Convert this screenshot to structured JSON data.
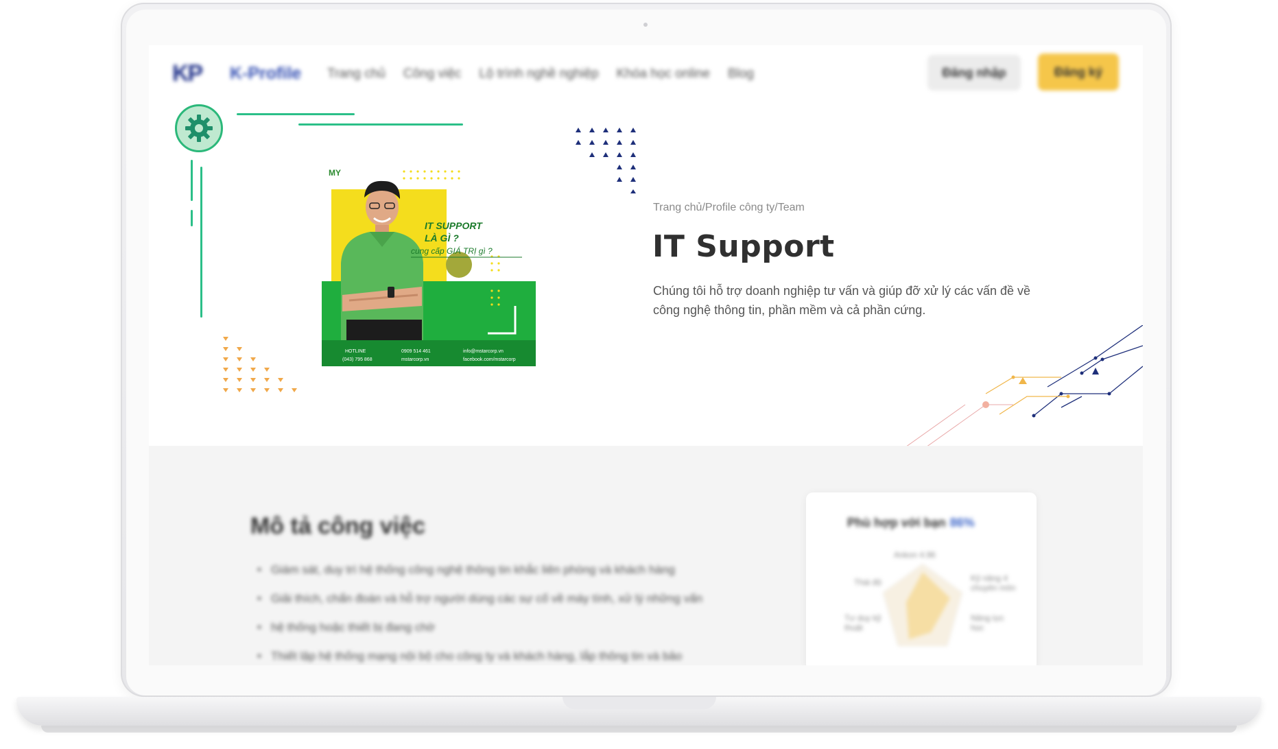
{
  "nav": {
    "logo_mark": "KP",
    "logo_text": "K-Profile",
    "links": [
      "Trang chủ",
      "Công việc",
      "Lộ trình nghề nghiệp",
      "Khóa học online",
      "Blog"
    ],
    "login_label": "Đăng nhập",
    "register_label": "Đăng ký"
  },
  "hero": {
    "breadcrumb": "Trang chủ/Profile công ty/Team",
    "title": "IT Support",
    "description": "Chúng tôi  hỗ trợ doanh nghiệp tư vấn và giúp đỡ xử lý các vấn đề về công nghệ thông tin, phần mềm và cả phần cứng.",
    "image": {
      "brand": "mstarcorp",
      "heading_line1": "IT SUPPORT",
      "heading_line2": "LÀ GÌ ?",
      "heading_line3": "cung cấp GIÁ TRỊ gì ?",
      "footer_left": "HOTLINE",
      "footer_phone": "(043) 795 868",
      "footer_mid1": "0909 514 461",
      "footer_mid2": "mstarcorp.vn",
      "footer_right1": "info@mstarcorp.vn",
      "footer_right2": "facebook.com/mstarcorp"
    }
  },
  "section": {
    "title": "Mô tả công việc",
    "bullets": [
      "Giám sát, duy trì hệ thống công nghệ thông tin khắc liên phòng và khách hàng",
      "Giải thích, chẩn đoán và hỗ trợ người dùng các sự cố về máy tính, xử lý những vấn",
      "hệ thống hoặc thiết bị đang chờ",
      "Thiết lập hệ thống mạng nội bộ cho công ty và khách hàng, lắp thông tin và bảo"
    ]
  },
  "card": {
    "title": "Phù hợp với bạn",
    "match_percent": "86%",
    "radar_labels": [
      "Ankon 4.96",
      "Kỹ năng 4 chuyên môn",
      "Thái độ",
      "Tư duy kỹ thuật",
      "Năng lực học"
    ]
  },
  "colors": {
    "accent_green": "#2bbf88",
    "brand_blue": "#22338a",
    "button_yellow": "#f5c64a",
    "title_text": "#303030"
  }
}
